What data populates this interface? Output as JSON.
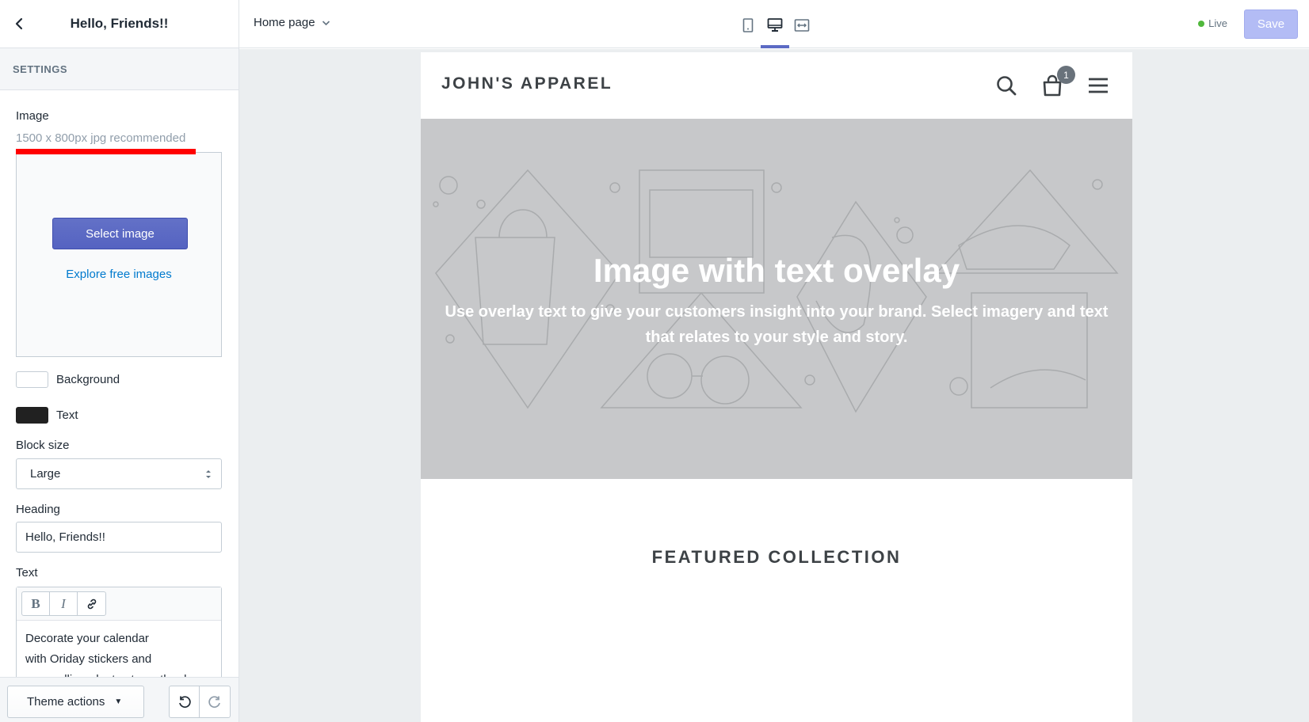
{
  "sidebar": {
    "title": "Hello, Friends!!",
    "section_label": "SETTINGS",
    "image_label": "Image",
    "image_hint": "1500 x 800px jpg recommended",
    "select_image_label": "Select image",
    "explore_label": "Explore free images",
    "background_label": "Background",
    "background_color": "#ffffff",
    "text_color_label": "Text",
    "text_color": "#212121",
    "block_size_label": "Block size",
    "block_size_value": "Large",
    "heading_label": "Heading",
    "heading_value": "Hello, Friends!!",
    "text_label": "Text",
    "rte_bold": "B",
    "rte_italic": "I",
    "text_lines": [
      "Decorate your calendar",
      "with Oriday stickers  and",
      "your calligraphy to stress the day"
    ]
  },
  "footer": {
    "theme_actions_label": "Theme actions"
  },
  "topbar": {
    "page_select": "Home page",
    "live_label": "Live",
    "save_label": "Save"
  },
  "store": {
    "logo": "JOHN'S APPAREL",
    "cart_count": "1",
    "hero_heading": "Image with text overlay",
    "hero_text": "Use overlay text to give your customers insight into your brand. Select imagery and text that relates to your style and story.",
    "featured_title": "FEATURED COLLECTION"
  },
  "colors": {
    "accent": "#5c6ac4",
    "link": "#007ace",
    "highlight_underline": "#ff0000",
    "live_dot": "#50b83c"
  }
}
